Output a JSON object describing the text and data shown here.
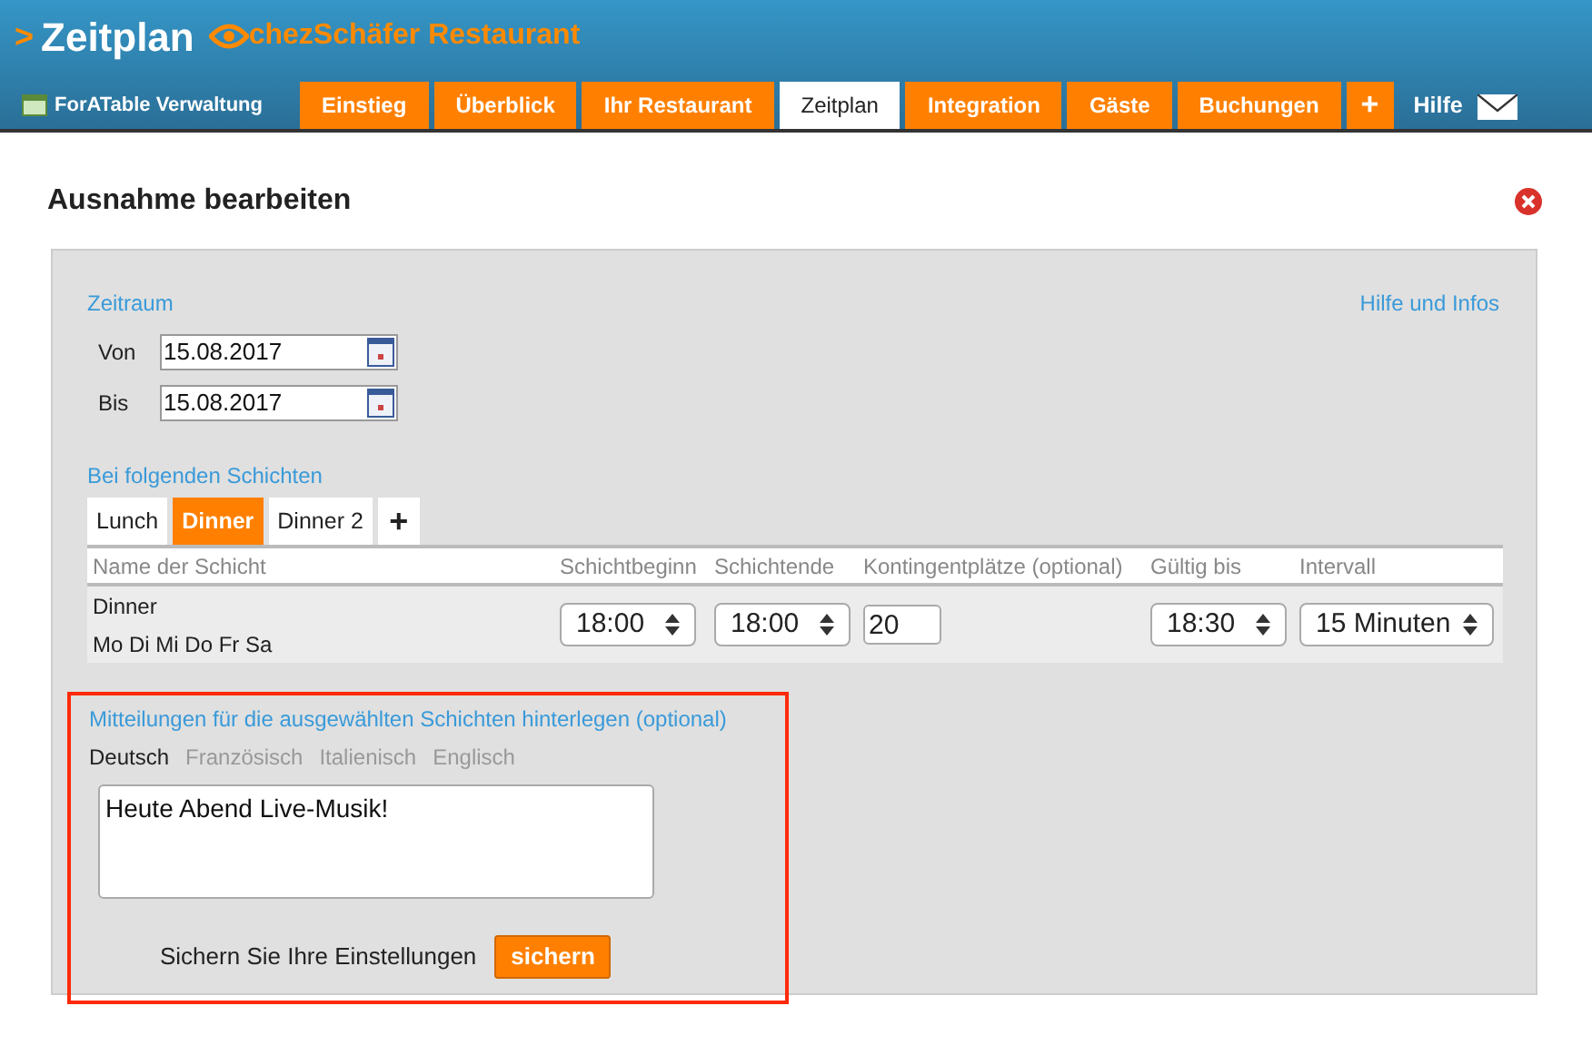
{
  "header": {
    "arrow": ">",
    "title": "Zeitplan",
    "restaurant": "chezSchäfer Restaurant"
  },
  "nav": {
    "admin": "ForATable Verwaltung",
    "tabs": [
      {
        "label": "Einstieg",
        "selected": false
      },
      {
        "label": "Überblick",
        "selected": false
      },
      {
        "label": "Ihr Restaurant",
        "selected": false
      },
      {
        "label": "Zeitplan",
        "selected": true
      },
      {
        "label": "Integration",
        "selected": false
      },
      {
        "label": "Gäste",
        "selected": false
      },
      {
        "label": "Buchungen",
        "selected": false
      },
      {
        "label": "+",
        "selected": false
      }
    ],
    "help": "Hilfe"
  },
  "dialog": {
    "title": "Ausnahme bearbeiten",
    "help_link": "Hilfe und Infos",
    "period": {
      "title": "Zeitraum",
      "fields": [
        {
          "label": "Von",
          "value": "15.08.2017"
        },
        {
          "label": "Bis",
          "value": "15.08.2017"
        }
      ]
    },
    "shifts": {
      "title": "Bei folgenden Schichten",
      "tabs": [
        {
          "label": "Lunch",
          "selected": false
        },
        {
          "label": "Dinner",
          "selected": true
        },
        {
          "label": "Dinner 2",
          "selected": false
        }
      ],
      "add": "+",
      "columns": [
        "Name der Schicht",
        "Schichtbeginn",
        "Schichtende",
        "Kontingentplätze (optional)",
        "Gültig bis",
        "Intervall"
      ],
      "row": {
        "name": "Dinner",
        "days": "Mo Di Mi Do Fr Sa",
        "start": "18:00",
        "end": "18:00",
        "quota": "20",
        "valid_until": "18:30",
        "interval": "15 Minuten"
      }
    },
    "messages": {
      "title": "Mitteilungen für die ausgewählten Schichten hinterlegen (optional)",
      "languages": [
        {
          "label": "Deutsch",
          "selected": true
        },
        {
          "label": "Französisch",
          "selected": false
        },
        {
          "label": "Italienisch",
          "selected": false
        },
        {
          "label": "Englisch",
          "selected": false
        }
      ],
      "text": "Heute Abend Live-Musik!",
      "save_hint": "Sichern Sie Ihre Einstellungen",
      "save": "sichern"
    }
  }
}
